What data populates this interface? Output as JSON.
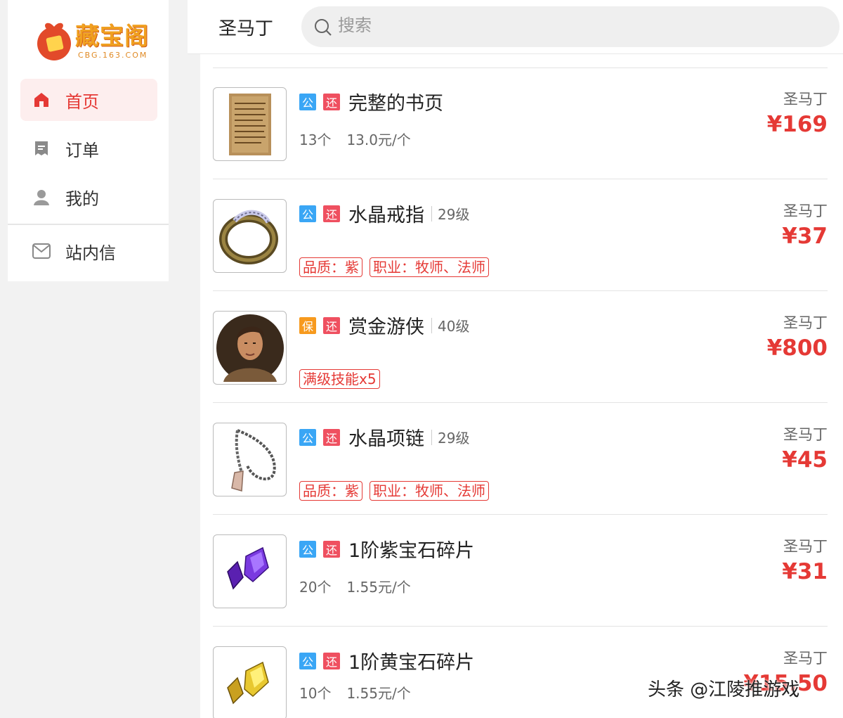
{
  "logo": {
    "brand": "藏宝阁",
    "domain": "CBG.163.COM"
  },
  "sidebar": {
    "items": [
      {
        "label": "首页",
        "icon": "home-icon",
        "active": true
      },
      {
        "label": "订单",
        "icon": "receipt-icon",
        "active": false
      },
      {
        "label": "我的",
        "icon": "user-icon",
        "active": false
      },
      {
        "label": "站内信",
        "icon": "mail-icon",
        "active": false
      }
    ]
  },
  "header": {
    "game": "圣马丁",
    "search_placeholder": "搜索"
  },
  "listings": [
    {
      "tags": [
        "公",
        "还"
      ],
      "name": "完整的书页",
      "level": "",
      "qty": "13个",
      "unit_price": "13.0元/个",
      "badges": [],
      "server": "圣马丁",
      "price": "¥169",
      "thumb": "scroll-page-icon"
    },
    {
      "tags": [
        "公",
        "还"
      ],
      "name": "水晶戒指",
      "level": "29级",
      "qty": "",
      "unit_price": "",
      "badges": [
        "品质：紫",
        "职业：牧师、法师"
      ],
      "server": "圣马丁",
      "price": "¥37",
      "thumb": "ring-icon"
    },
    {
      "tags": [
        "保",
        "还"
      ],
      "name": "赏金游侠",
      "level": "40级",
      "qty": "",
      "unit_price": "",
      "badges": [
        "满级技能x5"
      ],
      "server": "圣马丁",
      "price": "¥800",
      "thumb": "ranger-portrait"
    },
    {
      "tags": [
        "公",
        "还"
      ],
      "name": "水晶项链",
      "level": "29级",
      "qty": "",
      "unit_price": "",
      "badges": [
        "品质：紫",
        "职业：牧师、法师"
      ],
      "server": "圣马丁",
      "price": "¥45",
      "thumb": "necklace-icon"
    },
    {
      "tags": [
        "公",
        "还"
      ],
      "name": "1阶紫宝石碎片",
      "level": "",
      "qty": "20个",
      "unit_price": "1.55元/个",
      "badges": [],
      "server": "圣马丁",
      "price": "¥31",
      "thumb": "purple-gem-icon"
    },
    {
      "tags": [
        "公",
        "还"
      ],
      "name": "1阶黄宝石碎片",
      "level": "",
      "qty": "10个",
      "unit_price": "1.55元/个",
      "badges": [],
      "server": "圣马丁",
      "price": "¥15.50",
      "thumb": "yellow-gem-icon"
    }
  ],
  "watermark": "头条 @江陵推游戏",
  "colors": {
    "accent_red": "#e53935",
    "tag_blue": "#3aa6f5",
    "tag_orange": "#f79a1e",
    "tag_pink": "#ef5060"
  }
}
